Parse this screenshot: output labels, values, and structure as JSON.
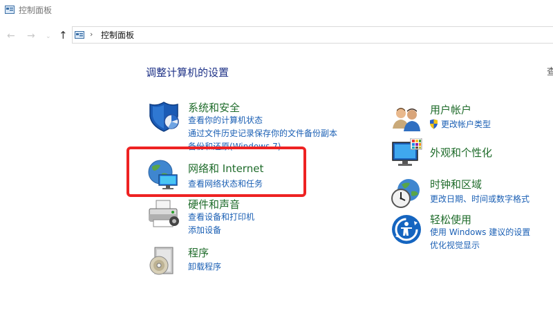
{
  "window": {
    "title": "控制面板"
  },
  "nav": {
    "back": "←",
    "forward": "→",
    "recent": "⌄",
    "up": "↑",
    "separator": "›",
    "address": "控制面板"
  },
  "main": {
    "heading": "调整计算机的设置",
    "view_by_partial": "查"
  },
  "left_categories": [
    {
      "title": "系统和安全",
      "icon": "shield-icon",
      "links": [
        "查看你的计算机状态",
        "通过文件历史记录保存你的文件备份副本",
        "备份和还原(Windows 7)"
      ]
    },
    {
      "title": "网络和 Internet",
      "icon": "network-globe-icon",
      "links": [
        "查看网络状态和任务"
      ]
    },
    {
      "title": "硬件和声音",
      "icon": "printer-icon",
      "links": [
        "查看设备和打印机",
        "添加设备"
      ]
    },
    {
      "title": "程序",
      "icon": "programs-disc-icon",
      "links": [
        "卸载程序"
      ]
    }
  ],
  "right_categories": [
    {
      "title": "用户帐户",
      "icon": "users-icon",
      "links": [
        "更改帐户类型"
      ]
    },
    {
      "title": "外观和个性化",
      "icon": "monitor-palette-icon",
      "links": []
    },
    {
      "title": "时钟和区域",
      "icon": "clock-globe-icon",
      "links": [
        "更改日期、时间或数字格式"
      ]
    },
    {
      "title": "轻松使用",
      "icon": "ease-of-access-icon",
      "links": [
        "使用 Windows 建议的设置",
        "优化视觉显示"
      ]
    }
  ],
  "colors": {
    "category_title": "#1e6b2a",
    "link": "#1a5fb4",
    "heading": "#1e3287",
    "highlight": "#ee2222"
  }
}
